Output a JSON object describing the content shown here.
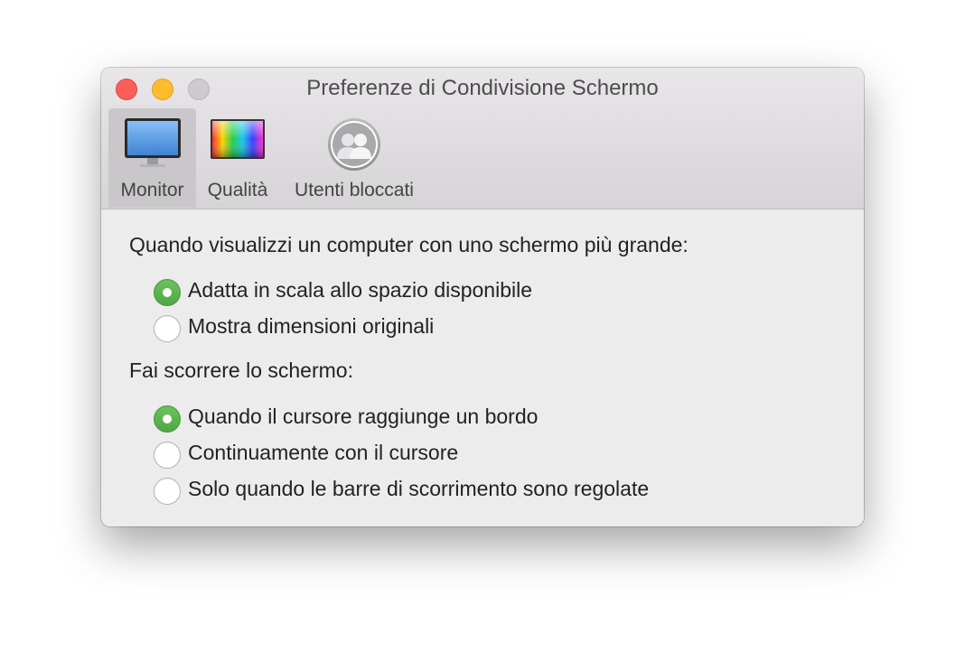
{
  "window": {
    "title": "Preferenze di Condivisione Schermo"
  },
  "toolbar": {
    "items": [
      {
        "label": "Monitor",
        "icon": "monitor-icon",
        "selected": true
      },
      {
        "label": "Qualità",
        "icon": "color-quality-icon",
        "selected": false
      },
      {
        "label": "Utenti bloccati",
        "icon": "users-group-icon",
        "selected": false
      }
    ]
  },
  "display_section": {
    "heading": "Quando visualizzi un computer con uno schermo più grande:",
    "options": [
      {
        "label": "Adatta in scala allo spazio disponibile",
        "selected": true
      },
      {
        "label": "Mostra dimensioni originali",
        "selected": false
      }
    ]
  },
  "scroll_section": {
    "heading": "Fai scorrere lo schermo:",
    "options": [
      {
        "label": "Quando il cursore raggiunge un bordo",
        "selected": true
      },
      {
        "label": "Continuamente con il cursore",
        "selected": false
      },
      {
        "label": "Solo quando le barre di scorrimento sono regolate",
        "selected": false
      }
    ]
  },
  "colors": {
    "accent_green": "#5cb551",
    "close": "#fc5f57",
    "minimize": "#fdbc2e",
    "zoom_disabled": "#cdcbcd"
  }
}
